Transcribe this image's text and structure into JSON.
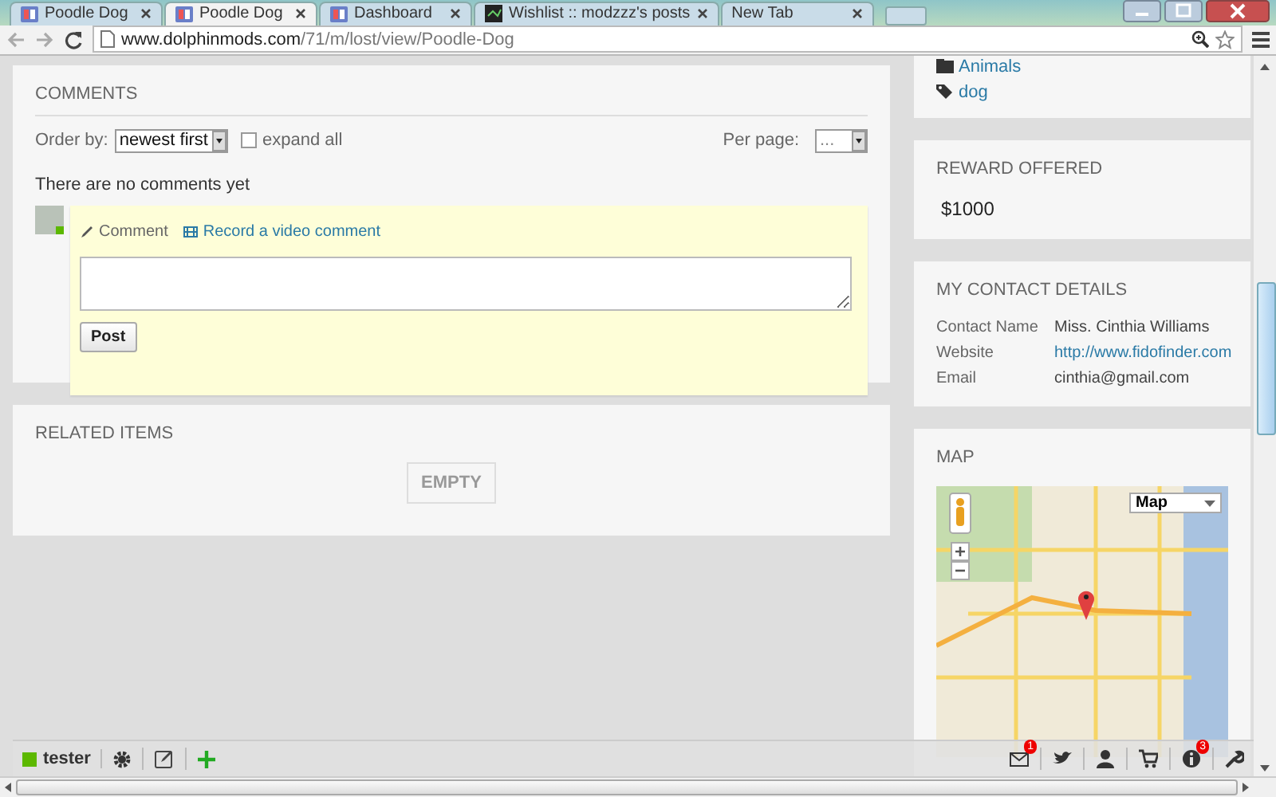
{
  "browser": {
    "tabs": [
      {
        "title": "Poodle Dog",
        "selected": false
      },
      {
        "title": "Poodle Dog",
        "selected": true
      },
      {
        "title": "Dashboard",
        "selected": false
      },
      {
        "title": "Wishlist :: modzzz's posts",
        "selected": false
      },
      {
        "title": "New Tab",
        "selected": false
      }
    ],
    "url": {
      "host": "www.dolphinmods.com",
      "path": "/71/m/lost/view/Poodle-Dog"
    }
  },
  "comments": {
    "title": "COMMENTS",
    "order_label": "Order by:",
    "order_value": "newest first",
    "expand_all": {
      "label": "expand all",
      "checked": false
    },
    "per_page_label": "Per page:",
    "per_page_value": "...",
    "empty_text": "There are no comments yet",
    "modes": [
      {
        "label": "Comment",
        "kind": "text",
        "selected": true
      },
      {
        "label": "Record a video comment",
        "kind": "video",
        "selected": false
      }
    ],
    "post_button": "Post"
  },
  "related": {
    "title": "RELATED ITEMS",
    "empty_label": "EMPTY"
  },
  "sidebar": {
    "taxonomy": [
      {
        "label": "Animals",
        "kind": "category"
      },
      {
        "label": "dog",
        "kind": "tag"
      }
    ],
    "reward": {
      "title": "REWARD OFFERED",
      "amount": "$1000"
    },
    "contact": {
      "title": "MY CONTACT DETAILS",
      "rows": [
        {
          "label": "Contact Name",
          "value": "Miss. Cinthia Williams",
          "kind": "text"
        },
        {
          "label": "Website",
          "value": "http://www.fidofinder.com",
          "kind": "link"
        },
        {
          "label": "Email",
          "value": "cinthia@gmail.com",
          "kind": "text"
        }
      ]
    },
    "map": {
      "title": "MAP",
      "map_type": "Map"
    }
  },
  "bottom_bar": {
    "user": {
      "name": "tester",
      "color": "#5cb800"
    },
    "icons": [
      {
        "kind": "mail",
        "badge": "1"
      },
      {
        "kind": "bird"
      },
      {
        "kind": "person"
      },
      {
        "kind": "cart"
      },
      {
        "kind": "info",
        "badge": "3"
      },
      {
        "kind": "wrench"
      }
    ]
  }
}
